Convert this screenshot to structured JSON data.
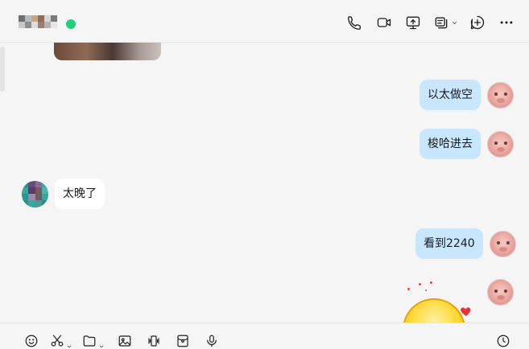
{
  "header": {
    "status": "online",
    "status_color": "#1fd17a",
    "actions": [
      {
        "name": "voice-call-icon"
      },
      {
        "name": "video-call-icon"
      },
      {
        "name": "screen-share-icon"
      },
      {
        "name": "remote-assist-icon"
      },
      {
        "name": "add-icon"
      },
      {
        "name": "more-icon"
      }
    ]
  },
  "messages": [
    {
      "side": "me",
      "text": "以太做空"
    },
    {
      "side": "me",
      "text": "梭哈进去"
    },
    {
      "side": "them",
      "text": "太晚了"
    },
    {
      "side": "me",
      "text": "看到2240"
    },
    {
      "side": "me",
      "type": "animated-emoji",
      "emoji": "sticker-emoji"
    }
  ],
  "colors": {
    "bubble_me": "#c9e6ff",
    "bubble_them": "#ffffff",
    "background": "#f5f5f5"
  },
  "toolbar": {
    "items": [
      {
        "name": "emoji-icon"
      },
      {
        "name": "scissors-icon"
      },
      {
        "name": "folder-icon"
      },
      {
        "name": "image-icon"
      },
      {
        "name": "vibrate-icon"
      },
      {
        "name": "red-packet-icon"
      },
      {
        "name": "microphone-icon"
      },
      {
        "name": "history-icon"
      }
    ]
  }
}
